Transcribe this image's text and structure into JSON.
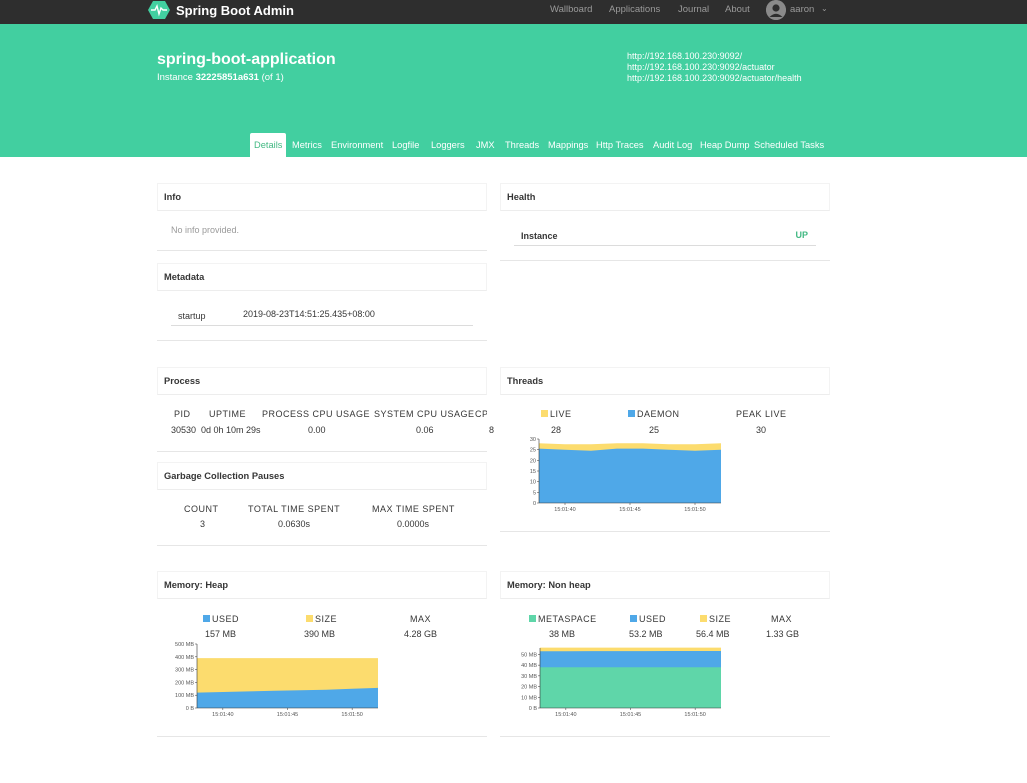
{
  "navbar": {
    "brand": "Spring Boot Admin",
    "links": [
      "Wallboard",
      "Applications",
      "Journal",
      "About"
    ],
    "user": "aaron"
  },
  "hero": {
    "title": "spring-boot-application",
    "instance_prefix": "Instance",
    "instance_id": "32225851a631",
    "instance_suffix": "(of 1)",
    "urls": [
      "http://192.168.100.230:9092/",
      "http://192.168.100.230:9092/actuator",
      "http://192.168.100.230:9092/actuator/health"
    ],
    "tabs": [
      "Details",
      "Metrics",
      "Environment",
      "Logfile",
      "Loggers",
      "JMX",
      "Threads",
      "Mappings",
      "Http Traces",
      "Audit Log",
      "Heap Dump",
      "Scheduled Tasks"
    ],
    "active_tab": "Details"
  },
  "colors": {
    "accent": "#42cfa0",
    "used": "#4fa8e8",
    "size": "#fcdc6e",
    "metaspace": "#5fd6a9",
    "up": "#42b983"
  },
  "info": {
    "title": "Info",
    "empty_text": "No info provided."
  },
  "health": {
    "title": "Health",
    "label": "Instance",
    "status": "UP"
  },
  "metadata": {
    "title": "Metadata",
    "key": "startup",
    "value": "2019-08-23T14:51:25.435+08:00"
  },
  "process": {
    "title": "Process",
    "columns": [
      "PID",
      "UPTIME",
      "PROCESS CPU USAGE",
      "SYSTEM CPU USAGE",
      "CPU"
    ],
    "values": [
      "30530",
      "0d 0h 10m 29s",
      "0.00",
      "0.06",
      "8"
    ]
  },
  "gc": {
    "title": "Garbage Collection Pauses",
    "columns": [
      "COUNT",
      "TOTAL TIME SPENT",
      "MAX TIME SPENT"
    ],
    "values": [
      "3",
      "0.0630s",
      "0.0000s"
    ]
  },
  "threads": {
    "title": "Threads",
    "legend": [
      {
        "label": "LIVE",
        "value": "28",
        "color": "#fcdc6e"
      },
      {
        "label": "DAEMON",
        "value": "25",
        "color": "#4fa8e8"
      },
      {
        "label": "PEAK LIVE",
        "value": "30",
        "color": ""
      }
    ]
  },
  "heap": {
    "title": "Memory: Heap",
    "legend": [
      {
        "label": "USED",
        "value": "157 MB",
        "color": "#4fa8e8"
      },
      {
        "label": "SIZE",
        "value": "390 MB",
        "color": "#fcdc6e"
      },
      {
        "label": "MAX",
        "value": "4.28 GB",
        "color": ""
      }
    ]
  },
  "nonheap": {
    "title": "Memory: Non heap",
    "legend": [
      {
        "label": "METASPACE",
        "value": "38 MB",
        "color": "#5fd6a9"
      },
      {
        "label": "USED",
        "value": "53.2 MB",
        "color": "#4fa8e8"
      },
      {
        "label": "SIZE",
        "value": "56.4 MB",
        "color": "#fcdc6e"
      },
      {
        "label": "MAX",
        "value": "1.33 GB",
        "color": ""
      }
    ]
  },
  "chart_data": [
    {
      "type": "area",
      "id": "threads",
      "x": [
        "15:01:38",
        "15:01:40",
        "15:01:42",
        "15:01:44",
        "15:01:46",
        "15:01:48",
        "15:01:50",
        "15:01:52"
      ],
      "xticks": [
        "15:01:40",
        "15:01:45",
        "15:01:50"
      ],
      "yticks": [
        "0",
        "5",
        "10",
        "15",
        "20",
        "25",
        "30"
      ],
      "ylim": [
        0,
        30
      ],
      "series": [
        {
          "name": "LIVE",
          "values": [
            28,
            27.5,
            27.5,
            28,
            28,
            27.5,
            27.5,
            28
          ],
          "color": "#fcdc6e"
        },
        {
          "name": "DAEMON",
          "values": [
            25.5,
            25,
            24.5,
            25.5,
            25.5,
            25,
            24.5,
            25
          ],
          "color": "#4fa8e8"
        }
      ]
    },
    {
      "type": "area",
      "id": "heap",
      "x": [
        "15:01:38",
        "15:01:40",
        "15:01:42",
        "15:01:44",
        "15:01:46",
        "15:01:48",
        "15:01:50",
        "15:01:52"
      ],
      "xticks": [
        "15:01:40",
        "15:01:45",
        "15:01:50"
      ],
      "yticks": [
        "0 B",
        "100 MB",
        "200 MB",
        "300 MB",
        "400 MB",
        "500 MB"
      ],
      "ylim": [
        0,
        500
      ],
      "series": [
        {
          "name": "SIZE",
          "values": [
            390,
            390,
            390,
            390,
            390,
            390,
            390,
            390
          ],
          "color": "#fcdc6e"
        },
        {
          "name": "USED",
          "values": [
            120,
            125,
            130,
            135,
            138,
            142,
            150,
            157
          ],
          "color": "#4fa8e8"
        }
      ]
    },
    {
      "type": "area",
      "id": "nonheap",
      "x": [
        "15:01:38",
        "15:01:40",
        "15:01:42",
        "15:01:44",
        "15:01:46",
        "15:01:48",
        "15:01:50",
        "15:01:52"
      ],
      "xticks": [
        "15:01:40",
        "15:01:45",
        "15:01:50"
      ],
      "yticks": [
        "0 B",
        "10 MB",
        "20 MB",
        "30 MB",
        "40 MB",
        "50 MB"
      ],
      "ylim": [
        0,
        56
      ],
      "series": [
        {
          "name": "SIZE",
          "values": [
            56.4,
            56.4,
            56.4,
            56.4,
            56.4,
            56.4,
            56.4,
            56.4
          ],
          "color": "#fcdc6e"
        },
        {
          "name": "USED",
          "values": [
            53,
            53,
            53.1,
            53.1,
            53.1,
            53.2,
            53.2,
            53.2
          ],
          "color": "#4fa8e8"
        },
        {
          "name": "METASPACE",
          "values": [
            38,
            38,
            38,
            38,
            38,
            38,
            38,
            38
          ],
          "color": "#5fd6a9"
        }
      ]
    }
  ]
}
